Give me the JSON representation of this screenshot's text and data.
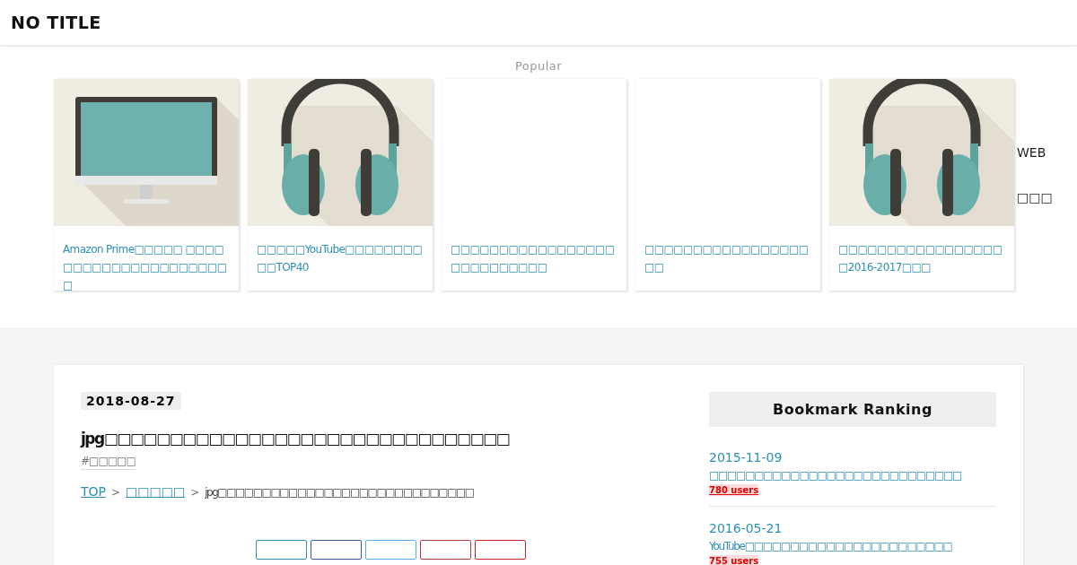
{
  "site_title": "NO TITLE",
  "popular": {
    "heading": "Popular",
    "cards": [
      {
        "kind": "monitor",
        "title": "Amazon Prime□□□□□ □□□□□□□□□□□□□□□□□□□□□□"
      },
      {
        "kind": "headphones",
        "title": "□□□□□YouTube□□□□□□□□□□TOP40"
      },
      {
        "kind": "blank",
        "title": "□□□□□□□□□□□□□□□□□□□□□□□□□□□"
      },
      {
        "kind": "blank",
        "title": "□□□□□□□□□□□□□□□□□□□"
      },
      {
        "kind": "headphones",
        "title": "□□□□□□□□□□□□□□□□□□2016-2017□□□",
        "overlay": [
          "WEB",
          "□□□"
        ]
      }
    ]
  },
  "article": {
    "date": "2018-08-27",
    "title": "jpg□□□□□□□□□□□□□□□□□□□□□□□□□□□□□□□",
    "tag": "#□□□□□",
    "breadcrumb": [
      {
        "kind": "link",
        "label": "TOP"
      },
      {
        "kind": "separator",
        "label": ">"
      },
      {
        "kind": "link",
        "label": "□□□□□"
      },
      {
        "kind": "separator",
        "label": ">"
      },
      {
        "kind": "current",
        "label": "jpg□□□□□□□□□□□□□□□□□□□□□□□□□□□□□"
      }
    ],
    "share_buttons": [
      {
        "color": "#2e8fb4"
      },
      {
        "color": "#3b5998"
      },
      {
        "color": "#55acee"
      },
      {
        "color": "#b23b3b"
      },
      {
        "color": "#cb2027"
      }
    ]
  },
  "sidebar": {
    "heading": "Bookmark Ranking",
    "items": [
      {
        "date": "2015-11-09",
        "title": "□□□□□□□□□□□□□□□□□□□□□□□□□□□□",
        "users": "780 users"
      },
      {
        "date": "2016-05-21",
        "title": "YouTube□□□□□□□□□□□□□□□□□□□□□□□",
        "users": "755 users"
      }
    ]
  }
}
